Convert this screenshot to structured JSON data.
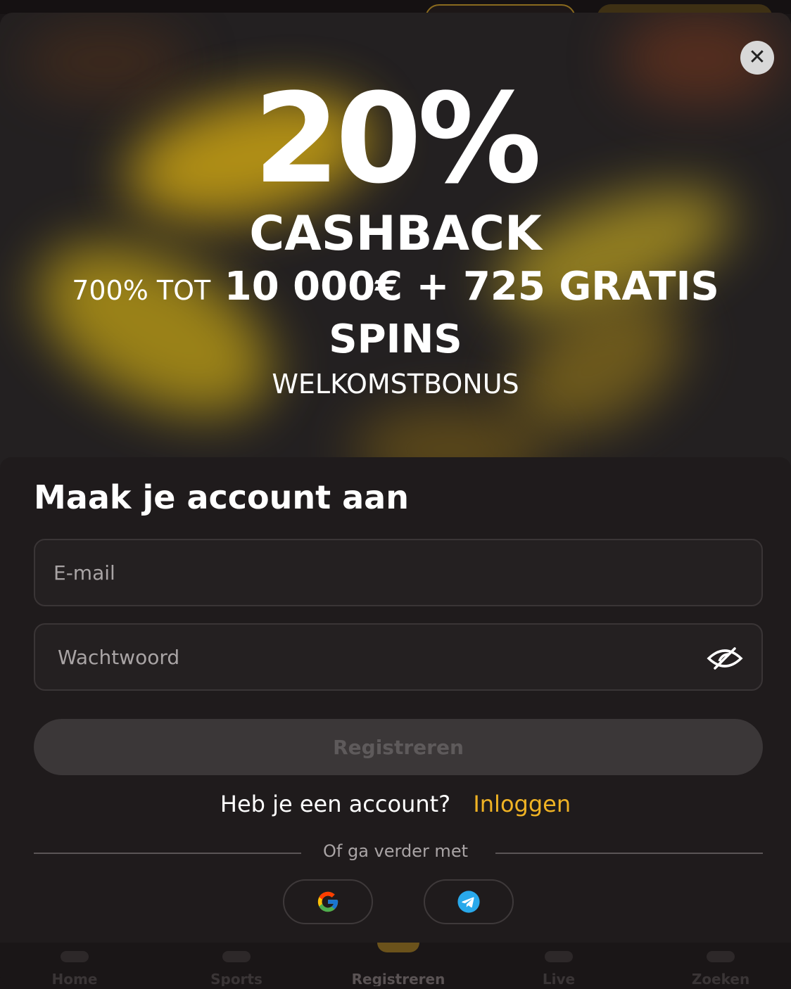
{
  "promo": {
    "percent": "20%",
    "cashback": "CASHBACK",
    "line_prefix": "700% TOT",
    "line_main": "10 000€ + 725 GRATIS",
    "line_spins": "SPINS",
    "welcome": "WELKOMSTBONUS"
  },
  "form": {
    "title": "Maak je account aan",
    "email_placeholder": "E-mail",
    "password_placeholder": "Wachtwoord",
    "register_label": "Registreren",
    "have_account": "Heb je een account?",
    "login_link": "Inloggen",
    "or_continue": "Of ga verder met"
  },
  "close_label": "✕",
  "social": [
    {
      "name": "google",
      "icon": "google-icon"
    },
    {
      "name": "telegram",
      "icon": "telegram-icon"
    }
  ],
  "bottom_nav": [
    {
      "label": "Home"
    },
    {
      "label": "Sports"
    },
    {
      "label": "Registreren"
    },
    {
      "label": "Live"
    },
    {
      "label": "Zoeken"
    }
  ],
  "colors": {
    "accent": "#f0b324",
    "background": "#1f1b1c",
    "button_disabled": "#3b3738"
  }
}
